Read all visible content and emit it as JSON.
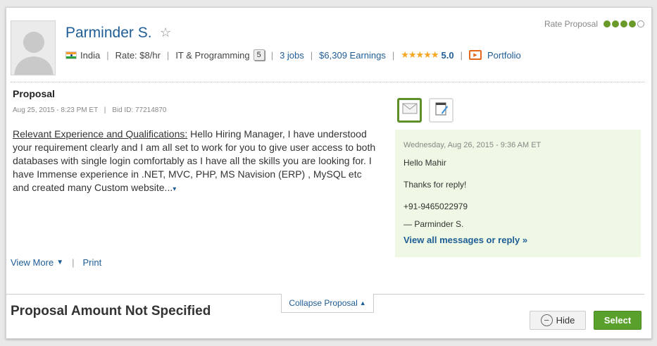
{
  "freelancer": {
    "name": "Parminder S.",
    "country": "India",
    "rate": "Rate: $8/hr",
    "category": "IT & Programming",
    "category_badge": "5",
    "jobs": "3 jobs",
    "earnings": "$6,309 Earnings",
    "rating_value": "5.0",
    "rating_stars": "★★★★★",
    "portfolio": "Portfolio"
  },
  "rate_proposal": {
    "label": "Rate Proposal",
    "level": 4,
    "max": 5
  },
  "proposal": {
    "title": "Proposal",
    "date": "Aug 25, 2015 - 8:23 PM ET",
    "bid_id": "Bid ID: 77214870",
    "heading": "Relevant Experience and Qualifications:",
    "text": " Hello Hiring Manager, I have understood your requirement clearly and I am all set to work for you to give user access to both databases with single login comfortably as I have all the skills you are looking for. I have Immense experience in .NET, MVC, PHP, MS Navision (ERP) , MySQL etc and created many Custom website...",
    "expand_caret": "▾",
    "view_more": "View More",
    "print": "Print"
  },
  "message": {
    "date": "Wednesday, Aug 26, 2015 - 9:36 AM ET",
    "greeting": "Hello Mahir",
    "body": "Thanks for reply!",
    "phone": "+91-9465022979",
    "signature": "— Parminder S.",
    "view_all": "View all messages or reply »"
  },
  "footer": {
    "collapse": "Collapse Proposal",
    "amount_title": "Proposal Amount Not Specified",
    "hide": "Hide",
    "select": "Select"
  },
  "colors": {
    "link": "#1f5d96",
    "accent_green": "#5aa02c",
    "message_bg": "#eef8e4"
  }
}
